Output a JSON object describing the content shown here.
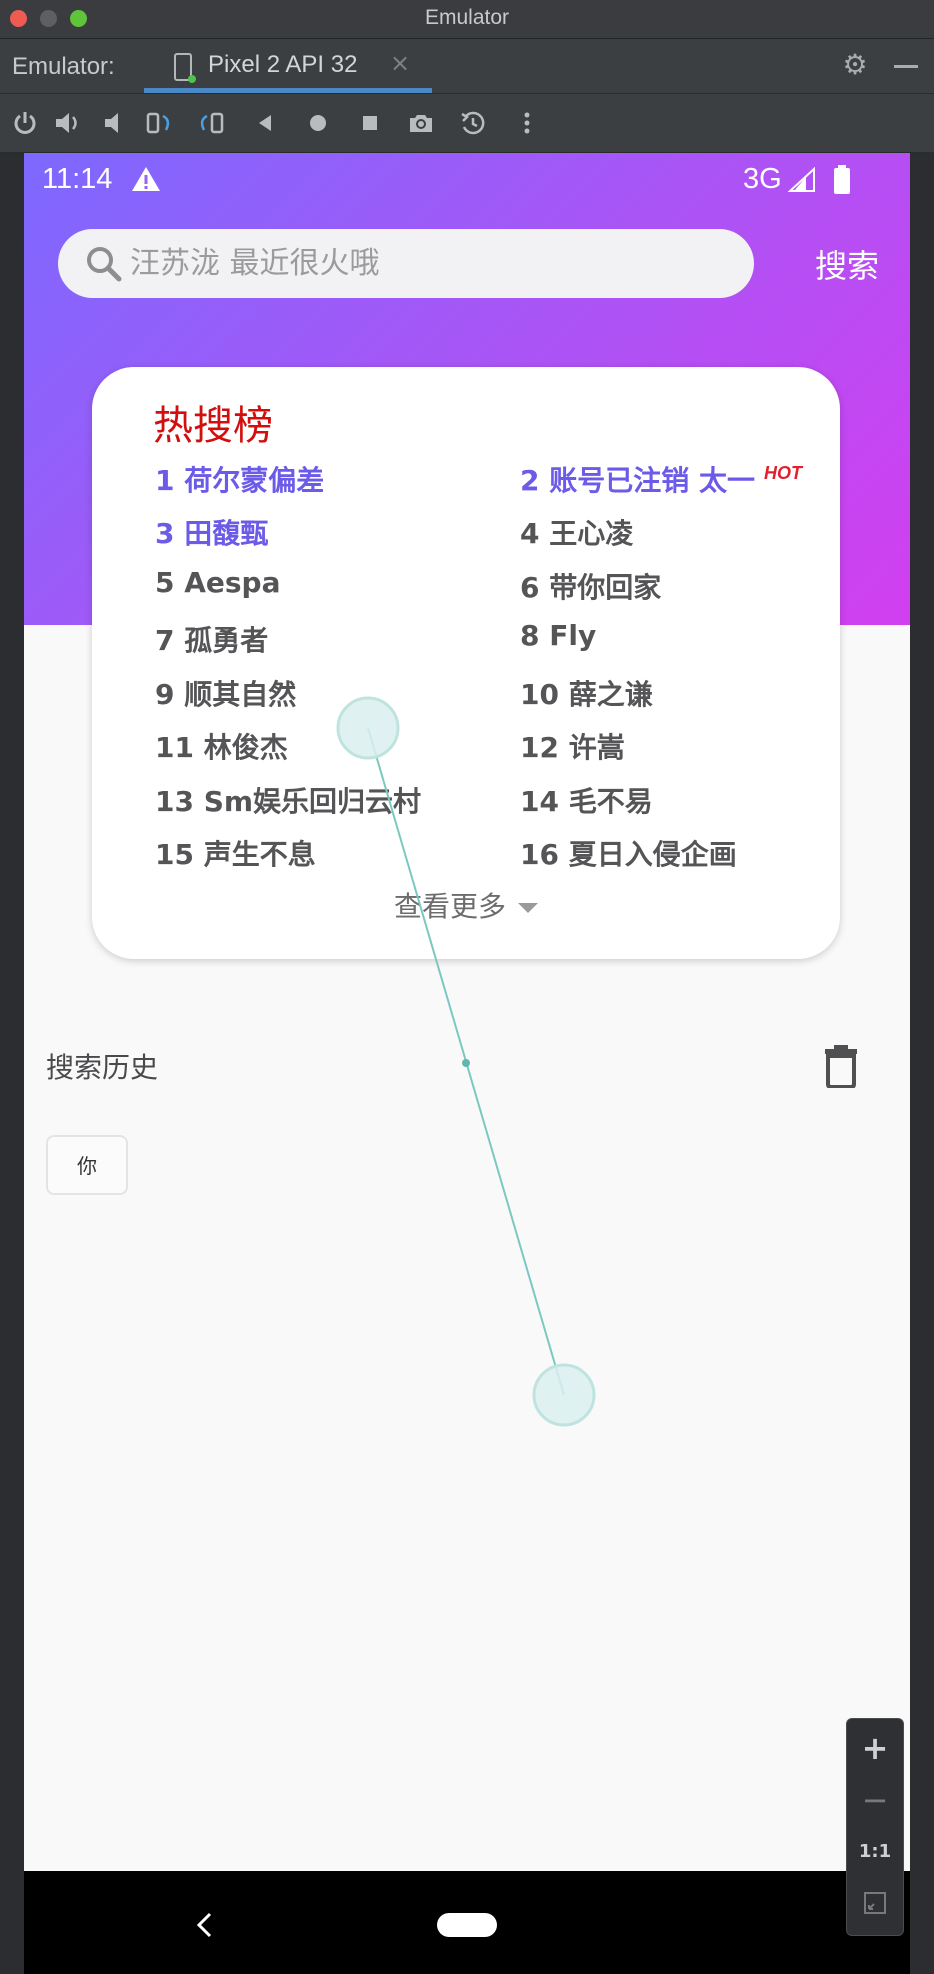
{
  "window": {
    "title": "Emulator"
  },
  "tool_window": {
    "label": "Emulator:",
    "device_tab": "Pixel 2 API 32",
    "close_glyph": "×"
  },
  "status_bar": {
    "time": "11:14",
    "network": "3G"
  },
  "search": {
    "placeholder": "汪苏泷 最近很火哦",
    "button_label": "搜索"
  },
  "hot_list": {
    "title": "热搜榜",
    "badge": "HOT",
    "items": [
      {
        "label": "1 荷尔蒙偏差",
        "highlight": true
      },
      {
        "label": "2 账号已注销 太一",
        "highlight": true
      },
      {
        "label": "3 田馥甄",
        "highlight": true
      },
      {
        "label": "4 王心凌",
        "highlight": false
      },
      {
        "label": "5 Aespa",
        "highlight": false
      },
      {
        "label": "6 带你回家",
        "highlight": false
      },
      {
        "label": "7 孤勇者",
        "highlight": false
      },
      {
        "label": "8 Fly",
        "highlight": false
      },
      {
        "label": "9 顺其自然",
        "highlight": false
      },
      {
        "label": "10 薛之谦",
        "highlight": false
      },
      {
        "label": "11 林俊杰",
        "highlight": false
      },
      {
        "label": "12 许嵩",
        "highlight": false
      },
      {
        "label": "13 Sm娱乐回归云村",
        "highlight": false
      },
      {
        "label": "14 毛不易",
        "highlight": false
      },
      {
        "label": "15 声生不息",
        "highlight": false
      },
      {
        "label": "16 夏日入侵企画",
        "highlight": false
      }
    ],
    "more_label": "查看更多"
  },
  "history": {
    "title": "搜索历史",
    "items": [
      "你"
    ]
  },
  "zoom_controls": {
    "zoom_in": "+",
    "zoom_out": "−",
    "actual_size": "1:1"
  },
  "colors": {
    "accent_purple": "#6b5be8",
    "hot_red": "#d10f0f",
    "gradient_start": "#7d69ff",
    "gradient_end": "#d23ff0"
  }
}
